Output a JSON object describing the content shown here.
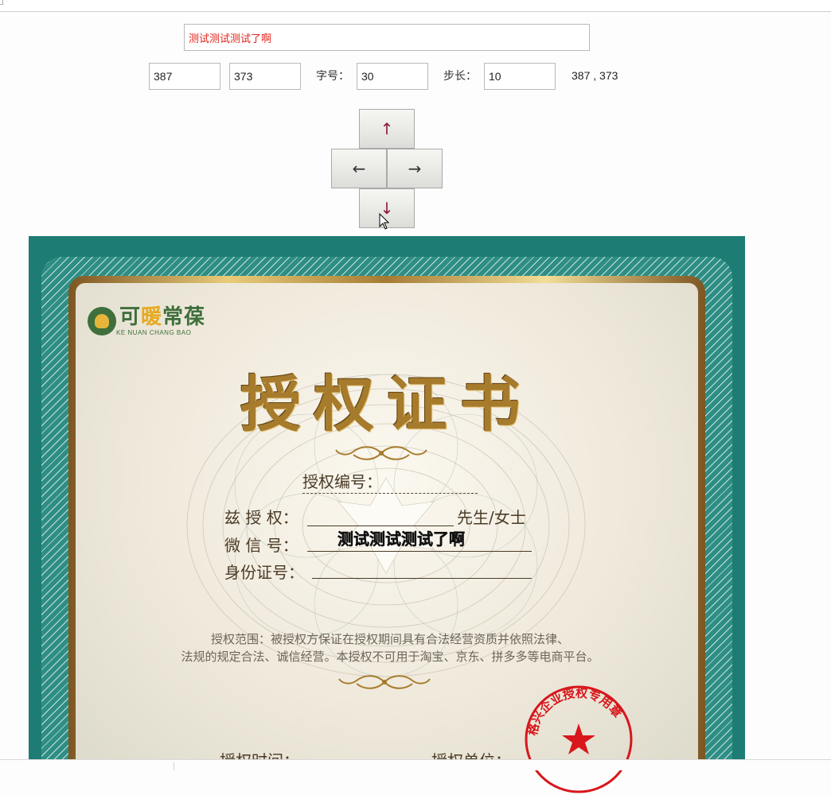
{
  "controls": {
    "text_input": "测试测试测试了啊",
    "x_input": "387",
    "y_input": "373",
    "font_size_label": "字号：",
    "font_size_input": "30",
    "step_label": "步长：",
    "step_input": "10",
    "coords_readout": "387 , 373"
  },
  "arrows": {
    "up": "↑",
    "left": "←",
    "right": "→",
    "down": "↓"
  },
  "certificate": {
    "logo_name_a": "可",
    "logo_name_b": "暖",
    "logo_name_c": "常葆",
    "logo_sub": "KE NUAN CHANG BAO",
    "title": "授权证书",
    "auth_no_label": "授权编号：",
    "grantee_label": "兹 授 权：",
    "grantee_suffix": "先生/女士",
    "wechat_label": "微 信 号：",
    "id_label": "身份证号：",
    "overlay_text": "测试测试测试了啊",
    "scope_line1": "授权范围：被授权方保证在授权期间具有合法经营资质并依照法律、",
    "scope_line2": "法规的规定合法、诚信经营。本授权不可用于淘宝、京东、拼多多等电商平台。",
    "time_label": "授权时间：",
    "unit_label": "授权单位：",
    "seal_text": "格兴企业授权专用章"
  },
  "colors": {
    "teal": "#1d7c73",
    "gold": "#a77b2c",
    "seal_red": "#d8161c",
    "input_text_red": "#e2231a"
  }
}
